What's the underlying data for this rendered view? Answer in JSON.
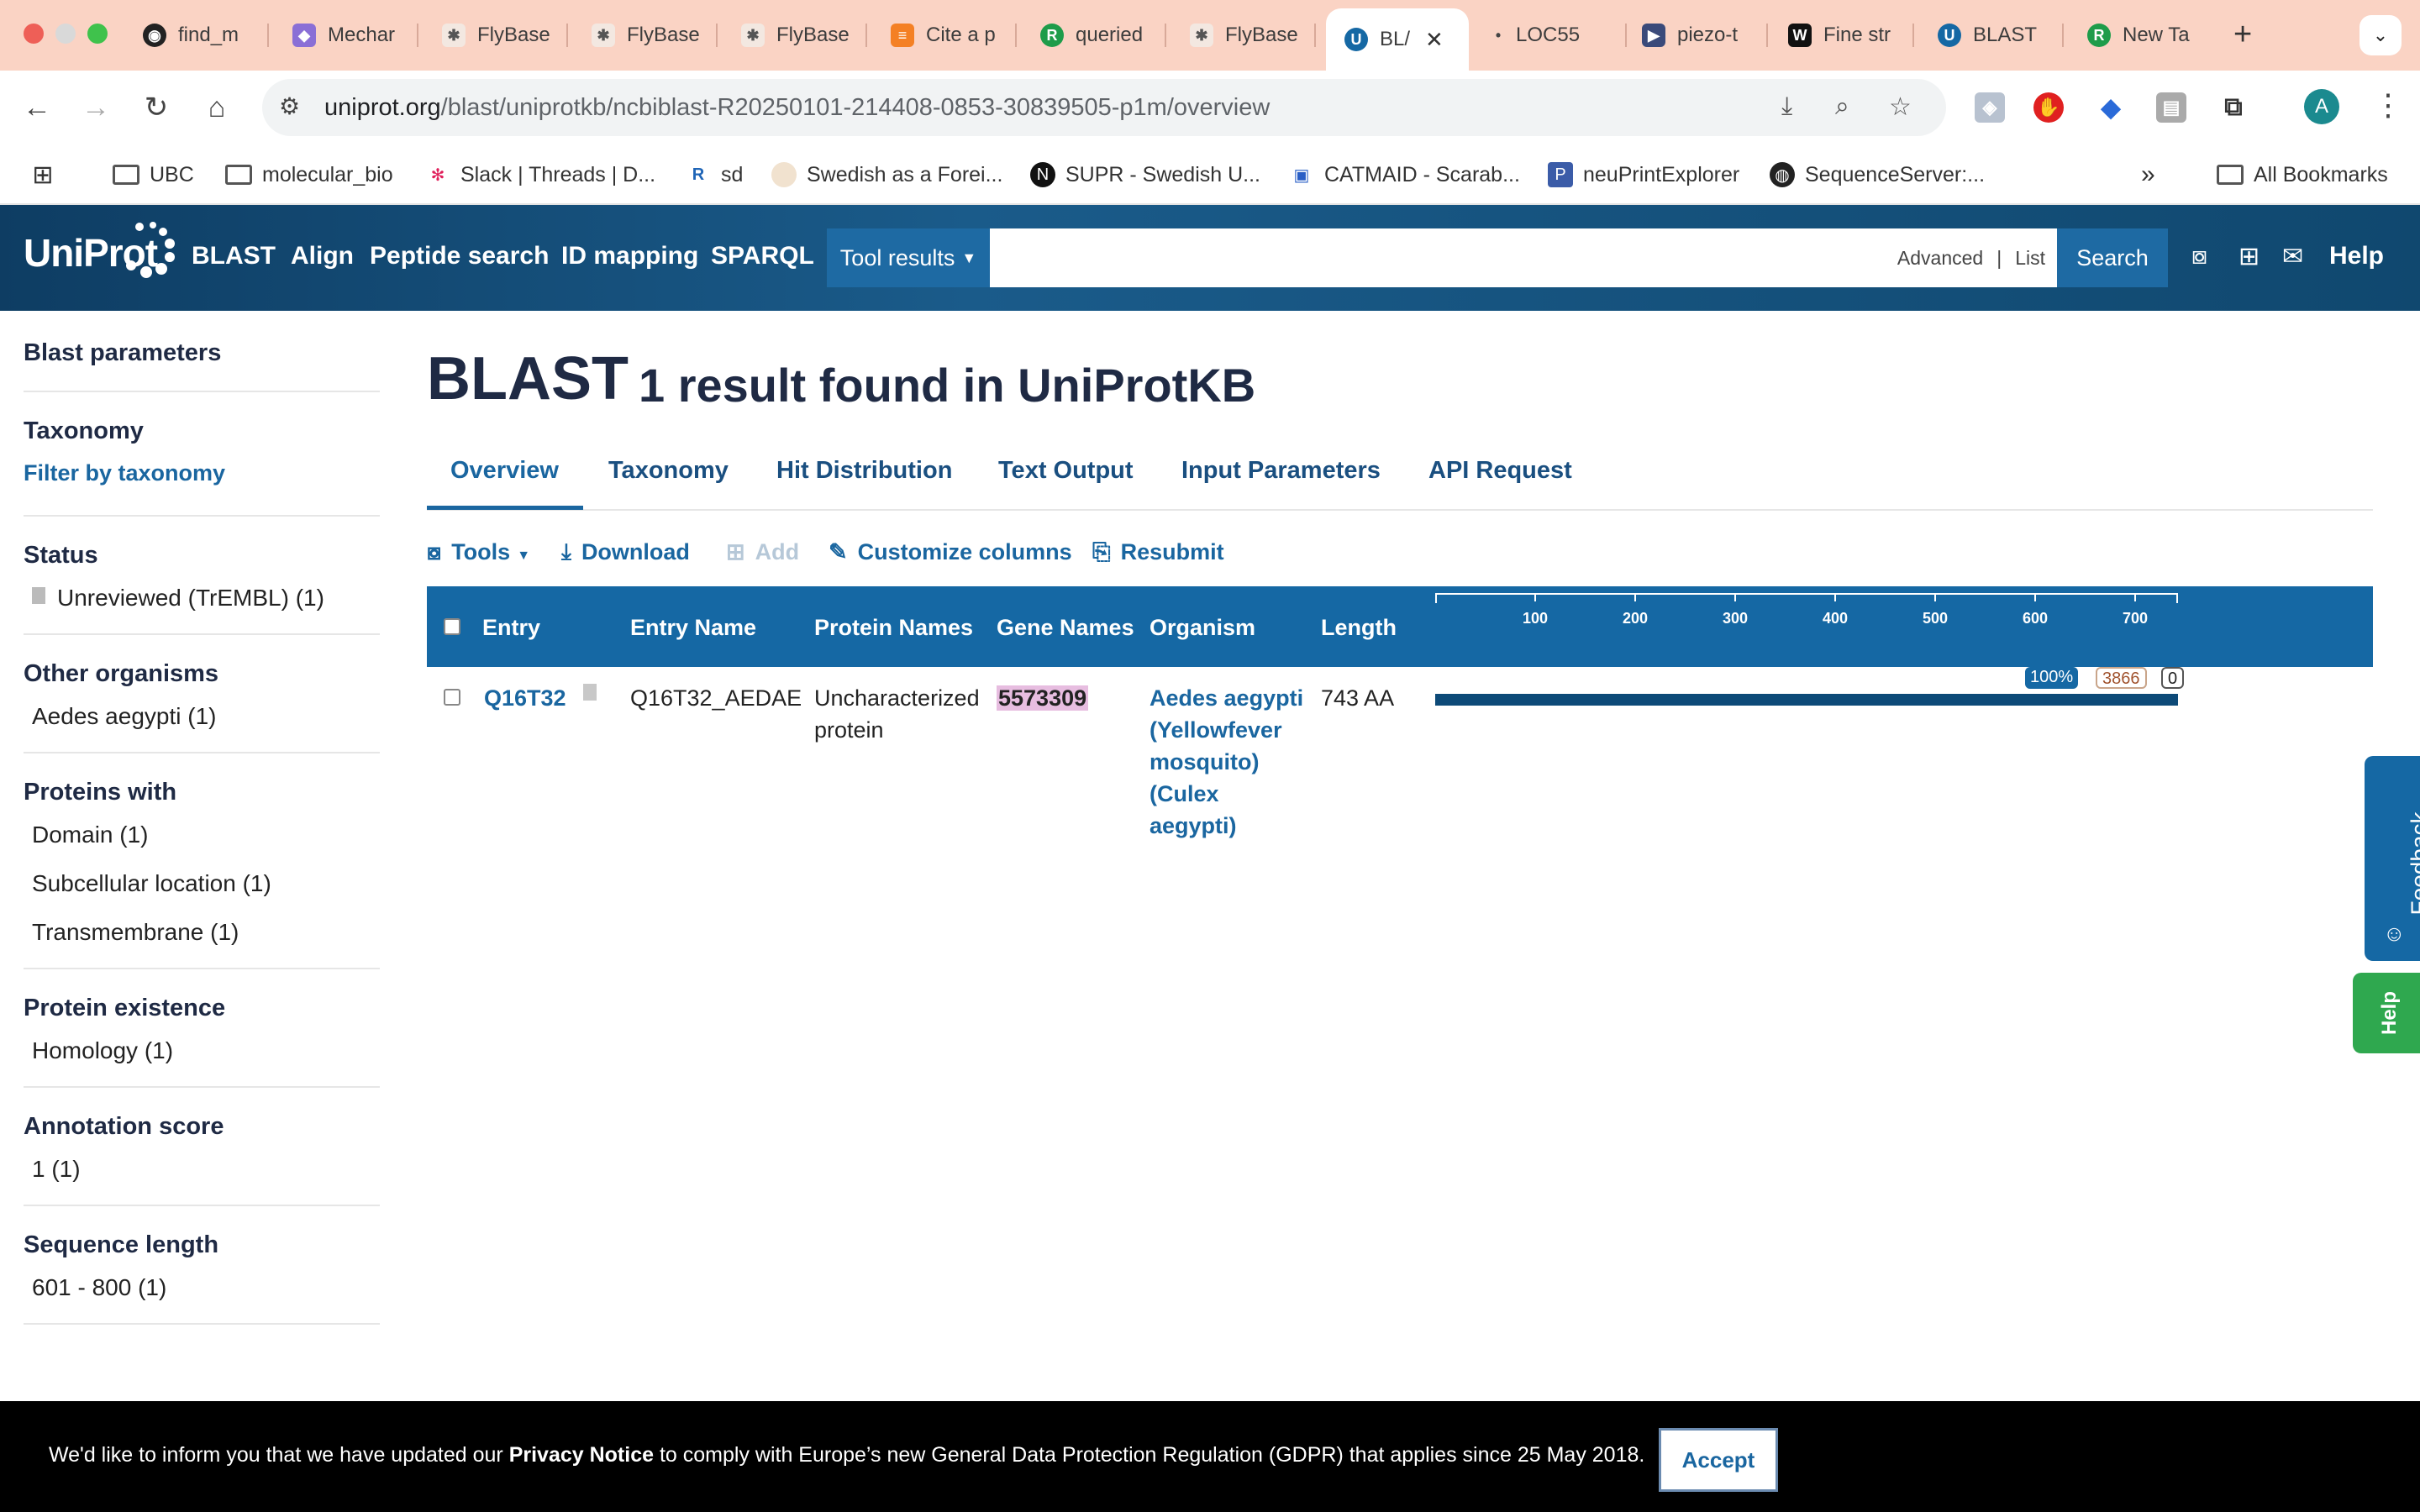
{
  "browser": {
    "tabs": [
      {
        "label": "find_m",
        "icon": "github-icon"
      },
      {
        "label": "Mechar",
        "icon": "layers-icon"
      },
      {
        "label": "FlyBase",
        "icon": "fly-icon"
      },
      {
        "label": "FlyBase",
        "icon": "fly-icon"
      },
      {
        "label": "FlyBase",
        "icon": "fly-icon"
      },
      {
        "label": "Cite a p",
        "icon": "stackoverflow-icon"
      },
      {
        "label": "queried",
        "icon": "green-circle-icon"
      },
      {
        "label": "FlyBase",
        "icon": "fly-icon"
      },
      {
        "label": "BL/",
        "icon": "uniprot-icon",
        "active": true
      },
      {
        "label": "LOC55",
        "icon": "dot-icon"
      },
      {
        "label": "piezo-t",
        "icon": "slides-icon"
      },
      {
        "label": "Fine str",
        "icon": "wikipedia-icon"
      },
      {
        "label": "BLAST",
        "icon": "uniprot-icon"
      },
      {
        "label": "New Ta",
        "icon": "green-circle-icon"
      }
    ],
    "url_host": "uniprot.org",
    "url_path": "/blast/uniprotkb/ncbiblast-R20250101-214408-0853-30839505-p1m/overview",
    "profile_initial": "A",
    "bookmarks": [
      "UBC",
      "molecular_bio",
      "Slack | Threads | D...",
      "sd",
      "Swedish as a Forei...",
      "SUPR - Swedish U...",
      "CATMAID - Scarab...",
      "neuPrintExplorer",
      "SequenceServer:..."
    ],
    "all_bookmarks": "All Bookmarks",
    "overflow": "»"
  },
  "uniprot": {
    "logo": "UniProt",
    "nav": [
      "BLAST",
      "Align",
      "Peptide search",
      "ID mapping",
      "SPARQL"
    ],
    "tool_results": "Tool results",
    "advanced": "Advanced",
    "list": "List",
    "search": "Search",
    "help": "Help"
  },
  "sidebar": {
    "blast_params": "Blast parameters",
    "sections": [
      {
        "title": "Taxonomy",
        "link": "Filter by taxonomy",
        "items": []
      },
      {
        "title": "Status",
        "items": [
          "Unreviewed (TrEMBL) (1)"
        ]
      },
      {
        "title": "Other organisms",
        "items": [
          "Aedes aegypti (1)"
        ]
      },
      {
        "title": "Proteins with",
        "items": [
          "Domain (1)",
          "Subcellular location (1)",
          "Transmembrane (1)"
        ]
      },
      {
        "title": "Protein existence",
        "items": [
          "Homology (1)"
        ]
      },
      {
        "title": "Annotation score",
        "items": [
          "1 (1)"
        ]
      },
      {
        "title": "Sequence length",
        "items": [
          "601 - 800 (1)"
        ]
      }
    ]
  },
  "main": {
    "title": "BLAST",
    "subtitle": "1 result found in UniProtKB",
    "tabs": [
      "Overview",
      "Taxonomy",
      "Hit Distribution",
      "Text Output",
      "Input Parameters",
      "API Request"
    ],
    "actions": {
      "tools": "Tools",
      "download": "Download",
      "add": "Add",
      "customize": "Customize columns",
      "resubmit": "Resubmit"
    },
    "columns": [
      "Entry",
      "Entry Name",
      "Protein Names",
      "Gene Names",
      "Organism",
      "Length"
    ],
    "axis_ticks": [
      "100",
      "200",
      "300",
      "400",
      "500",
      "600",
      "700"
    ],
    "rows": [
      {
        "entry": "Q16T32",
        "entry_name": "Q16T32_AEDAE",
        "protein_line1": "Uncharacterized",
        "protein_line2": "protein",
        "gene": "5573309",
        "organism_lines": [
          "Aedes aegypti",
          "(Yellowfever",
          "mosquito)",
          "(Culex",
          "aegypti)"
        ],
        "length": "743 AA",
        "identity": "100%",
        "score": "3866",
        "evalue": "0"
      }
    ]
  },
  "widgets": {
    "feedback": "Feedback",
    "help": "Help"
  },
  "gdpr": {
    "text_before": "We'd like to inform you that we have updated our ",
    "privacy": "Privacy Notice",
    "text_after": " to comply with Europe’s new General Data Protection Regulation (GDPR) that applies since 25 May 2018.",
    "accept": "Accept"
  }
}
